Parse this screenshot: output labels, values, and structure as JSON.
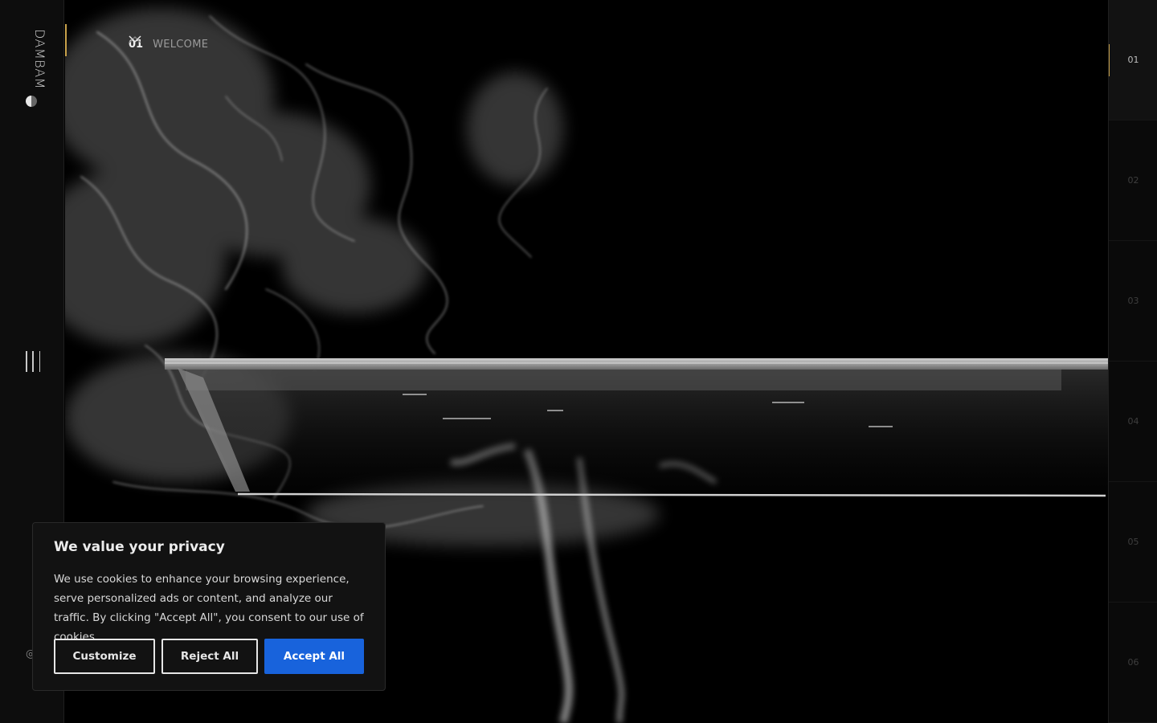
{
  "brand": {
    "logo_text": "DAMBAM"
  },
  "slide_nav": {
    "number": "01",
    "label": "WELCOME"
  },
  "sections": [
    "01",
    "02",
    "03",
    "04",
    "05",
    "06"
  ],
  "active_section": "01",
  "cookie_banner": {
    "title": "We value your privacy",
    "text": "We use cookies to enhance your browsing experience, serve personalized ads or content, and analyze our traffic. By clicking \"Accept All\", you consent to our use of cookies.",
    "customize_label": "Customize",
    "reject_label": "Reject All",
    "accept_label": "Accept All"
  },
  "colors": {
    "accent_gold": "#c9a24b",
    "accept_blue": "#1863dc",
    "background": "#000000"
  }
}
